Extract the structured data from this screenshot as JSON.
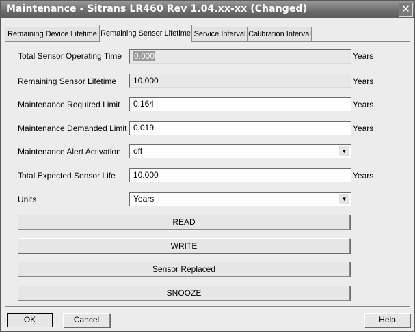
{
  "window": {
    "title": "Maintenance - Sitrans LR460 Rev 1.04.xx-xx (Changed)",
    "close_glyph": "✕"
  },
  "tabs": [
    {
      "label": "Remaining Device Lifetime"
    },
    {
      "label": "Remaining Sensor Lifetime",
      "active": true
    },
    {
      "label": "Service Interval"
    },
    {
      "label": "Calibration Interval"
    }
  ],
  "form": {
    "total_operating_time": {
      "label": "Total Sensor Operating Time",
      "value": "0.000",
      "unit": "Years"
    },
    "remaining_lifetime": {
      "label": "Remaining Sensor Lifetime",
      "value": "10.000",
      "unit": "Years"
    },
    "maint_required": {
      "label": "Maintenance Required Limit",
      "value": "0.164",
      "unit": "Years"
    },
    "maint_demanded": {
      "label": "Maintenance Demanded Limit",
      "value": "0.019",
      "unit": "Years"
    },
    "alert_activation": {
      "label": "Maintenance Alert Activation",
      "value": "off"
    },
    "expected_life": {
      "label": "Total Expected Sensor Life",
      "value": "10.000",
      "unit": "Years"
    },
    "units": {
      "label": "Units",
      "value": "Years"
    }
  },
  "actions": {
    "read": "READ",
    "write": "WRITE",
    "sensor_replaced": "Sensor Replaced",
    "snooze": "SNOOZE"
  },
  "footer": {
    "ok": "OK",
    "cancel": "Cancel",
    "help": "Help"
  },
  "icons": {
    "dropdown": "▼"
  }
}
